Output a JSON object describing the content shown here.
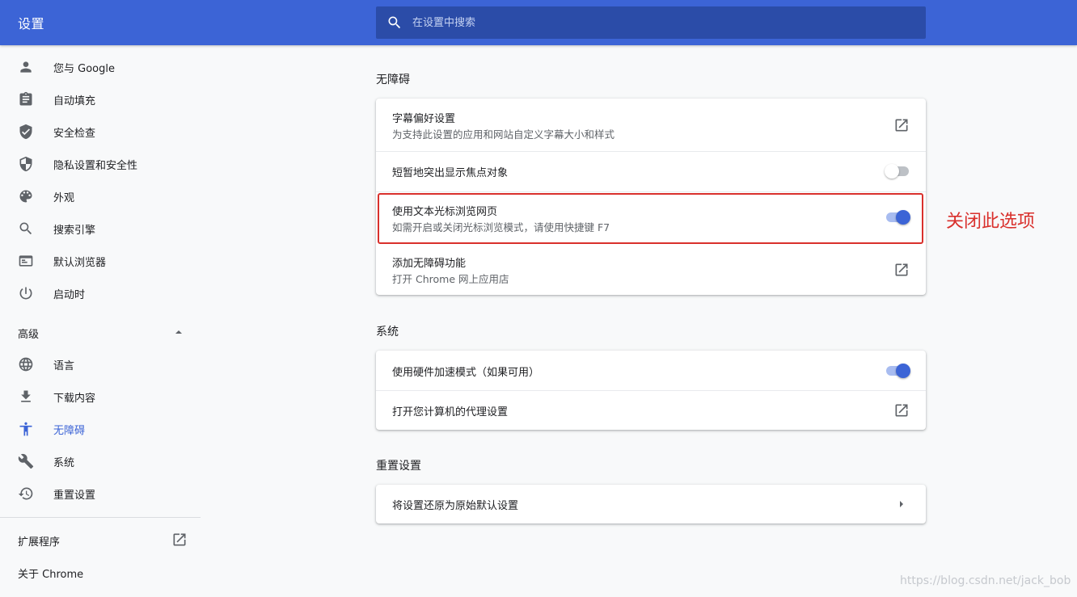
{
  "header": {
    "title": "设置",
    "search_placeholder": "在设置中搜索"
  },
  "sidebar": {
    "items": [
      {
        "label": "您与 Google",
        "icon": "person-icon"
      },
      {
        "label": "自动填充",
        "icon": "clipboard-icon"
      },
      {
        "label": "安全检查",
        "icon": "shield-check-icon"
      },
      {
        "label": "隐私设置和安全性",
        "icon": "shield-half-icon"
      },
      {
        "label": "外观",
        "icon": "palette-icon"
      },
      {
        "label": "搜索引擎",
        "icon": "search-icon"
      },
      {
        "label": "默认浏览器",
        "icon": "browser-icon"
      },
      {
        "label": "启动时",
        "icon": "power-icon"
      }
    ],
    "advanced_label": "高级",
    "advanced_items": [
      {
        "label": "语言",
        "icon": "globe-icon"
      },
      {
        "label": "下载内容",
        "icon": "download-icon"
      },
      {
        "label": "无障碍",
        "icon": "accessibility-icon",
        "active": true
      },
      {
        "label": "系统",
        "icon": "wrench-icon"
      },
      {
        "label": "重置设置",
        "icon": "restore-icon"
      }
    ],
    "extensions_label": "扩展程序",
    "about_label": "关于 Chrome"
  },
  "accessibility": {
    "section_title": "无障碍",
    "captions_title": "字幕偏好设置",
    "captions_sub": "为支持此设置的应用和网站自定义字幕大小和样式",
    "focus_title": "短暂地突出显示焦点对象",
    "focus_enabled": false,
    "caret_title": "使用文本光标浏览网页",
    "caret_sub": "如需开启或关闭光标浏览模式，请使用快捷键 F7",
    "caret_enabled": true,
    "add_title": "添加无障碍功能",
    "add_sub": "打开 Chrome 网上应用店"
  },
  "system": {
    "section_title": "系统",
    "hw_accel_title": "使用硬件加速模式（如果可用）",
    "hw_accel_enabled": true,
    "proxy_title": "打开您计算机的代理设置"
  },
  "reset": {
    "section_title": "重置设置",
    "restore_title": "将设置还原为原始默认设置"
  },
  "annotation": "关闭此选项",
  "watermark": "https://blog.csdn.net/jack_bob",
  "colors": {
    "header": "#3c64d6",
    "accent": "#3c64d6",
    "annotation_red": "#d9302c"
  }
}
